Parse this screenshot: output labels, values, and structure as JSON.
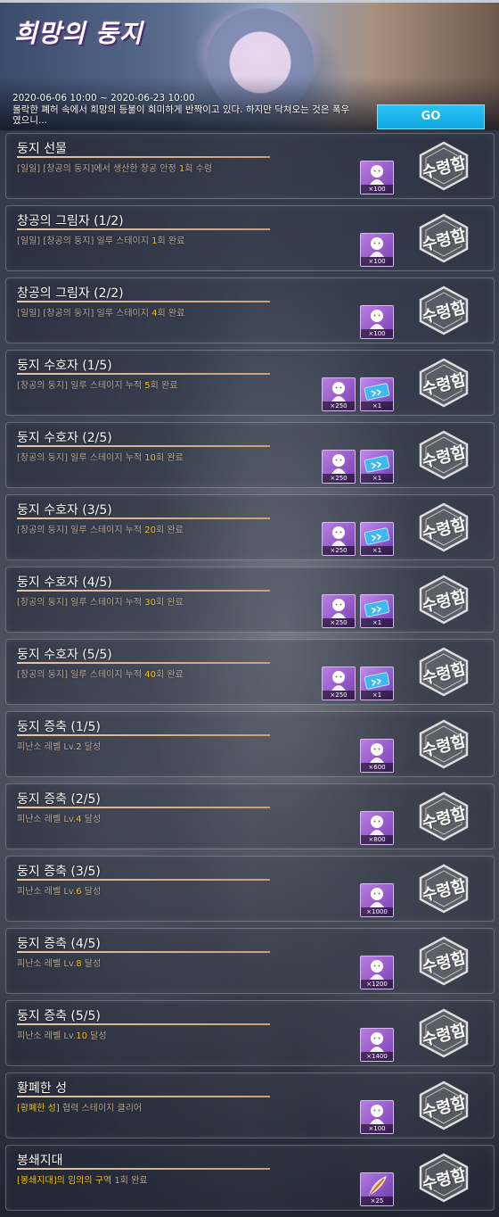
{
  "banner": {
    "title": "희망의 둥지",
    "date_range": "2020-06-06 10:00 ~ 2020-06-23 10:00",
    "description": "몰락한 폐허 속에서 희망의 등불이 희미하게 반짝이고 있다. 하지만 닥쳐오는 것은 폭우였으니...",
    "go_label": "GO"
  },
  "stamp_label": "수령함",
  "missions": [
    {
      "title": "둥지 선물",
      "desc_pre": "[일일] [창공의 둥지]에서 생산한 창공 안정 ",
      "desc_hl": "1",
      "desc_post": "회 수령",
      "rewards": [
        {
          "type": "doll",
          "count": "×100"
        }
      ]
    },
    {
      "title": "창공의 그림자 (1/2)",
      "desc_pre": "[일일] [창공의 둥지] 일루 스테이지 ",
      "desc_hl": "1",
      "desc_post": "회 완료",
      "rewards": [
        {
          "type": "doll",
          "count": "×100"
        }
      ]
    },
    {
      "title": "창공의 그림자 (2/2)",
      "desc_pre": "[일일] [창공의 둥지] 일루 스테이지 ",
      "desc_hl": "4",
      "desc_post": "회 완료",
      "rewards": [
        {
          "type": "doll",
          "count": "×100"
        }
      ]
    },
    {
      "title": "둥지 수호자 (1/5)",
      "desc_pre": "[창공의 둥지] 일루 스테이지 누적 ",
      "desc_hl": "5",
      "desc_post": "회 완료",
      "rewards": [
        {
          "type": "doll",
          "count": "×250"
        },
        {
          "type": "ticket",
          "count": "×1"
        }
      ]
    },
    {
      "title": "둥지 수호자 (2/5)",
      "desc_pre": "[창공의 둥지] 일루 스테이지 누적 ",
      "desc_hl": "10",
      "desc_post": "회 완료",
      "rewards": [
        {
          "type": "doll",
          "count": "×250"
        },
        {
          "type": "ticket",
          "count": "×1"
        }
      ]
    },
    {
      "title": "둥지 수호자 (3/5)",
      "desc_pre": "[창공의 둥지] 일루 스테이지 누적 ",
      "desc_hl": "20",
      "desc_post": "회 완료",
      "rewards": [
        {
          "type": "doll",
          "count": "×250"
        },
        {
          "type": "ticket",
          "count": "×1"
        }
      ]
    },
    {
      "title": "둥지 수호자 (4/5)",
      "desc_pre": "[창공의 둥지] 일루 스테이지 누적 ",
      "desc_hl": "30",
      "desc_post": "회 완료",
      "rewards": [
        {
          "type": "doll",
          "count": "×250"
        },
        {
          "type": "ticket",
          "count": "×1"
        }
      ]
    },
    {
      "title": "둥지 수호자 (5/5)",
      "desc_pre": "[창공의 둥지] 일루 스테이지 누적 ",
      "desc_hl": "40",
      "desc_post": "회 완료",
      "rewards": [
        {
          "type": "doll",
          "count": "×250"
        },
        {
          "type": "ticket",
          "count": "×1"
        }
      ]
    },
    {
      "title": "둥지 증축 (1/5)",
      "desc_pre": "피난소 레벨 Lv.",
      "desc_hl": "2",
      "desc_post": " 달성",
      "rewards": [
        {
          "type": "doll",
          "count": "×600"
        }
      ]
    },
    {
      "title": "둥지 증축 (2/5)",
      "desc_pre": "피난소 레벨 Lv.",
      "desc_hl": "4",
      "desc_post": " 달성",
      "rewards": [
        {
          "type": "doll",
          "count": "×800"
        }
      ]
    },
    {
      "title": "둥지 증축 (3/5)",
      "desc_pre": "피난소 레벨 Lv.",
      "desc_hl": "6",
      "desc_post": " 달성",
      "rewards": [
        {
          "type": "doll",
          "count": "×1000"
        }
      ]
    },
    {
      "title": "둥지 증축 (4/5)",
      "desc_pre": "피난소 레벨 Lv.",
      "desc_hl": "8",
      "desc_post": " 달성",
      "rewards": [
        {
          "type": "doll",
          "count": "×1200"
        }
      ]
    },
    {
      "title": "둥지 증축 (5/5)",
      "desc_pre": "피난소 레벨 Lv.",
      "desc_hl": "10",
      "desc_post": " 달성",
      "rewards": [
        {
          "type": "doll",
          "count": "×1400"
        }
      ]
    },
    {
      "title": "황폐한 성",
      "desc_pre": "",
      "desc_hl": "[황폐한 성]",
      "desc_post": " 협력 스테이지 클리어",
      "rewards": [
        {
          "type": "doll",
          "count": "×100"
        }
      ]
    },
    {
      "title": "봉쇄지대",
      "desc_pre": "",
      "desc_hl": "[봉쇄지대]의 임의의 구역",
      "desc_post": " 1회 완료",
      "rewards": [
        {
          "type": "feather",
          "count": "×25"
        }
      ]
    }
  ],
  "colors": {
    "accent": "#f5c518",
    "go_button": "#1ab4ec",
    "progress_bar": "#d9b896",
    "reward_bg": "#9a5fd0"
  }
}
